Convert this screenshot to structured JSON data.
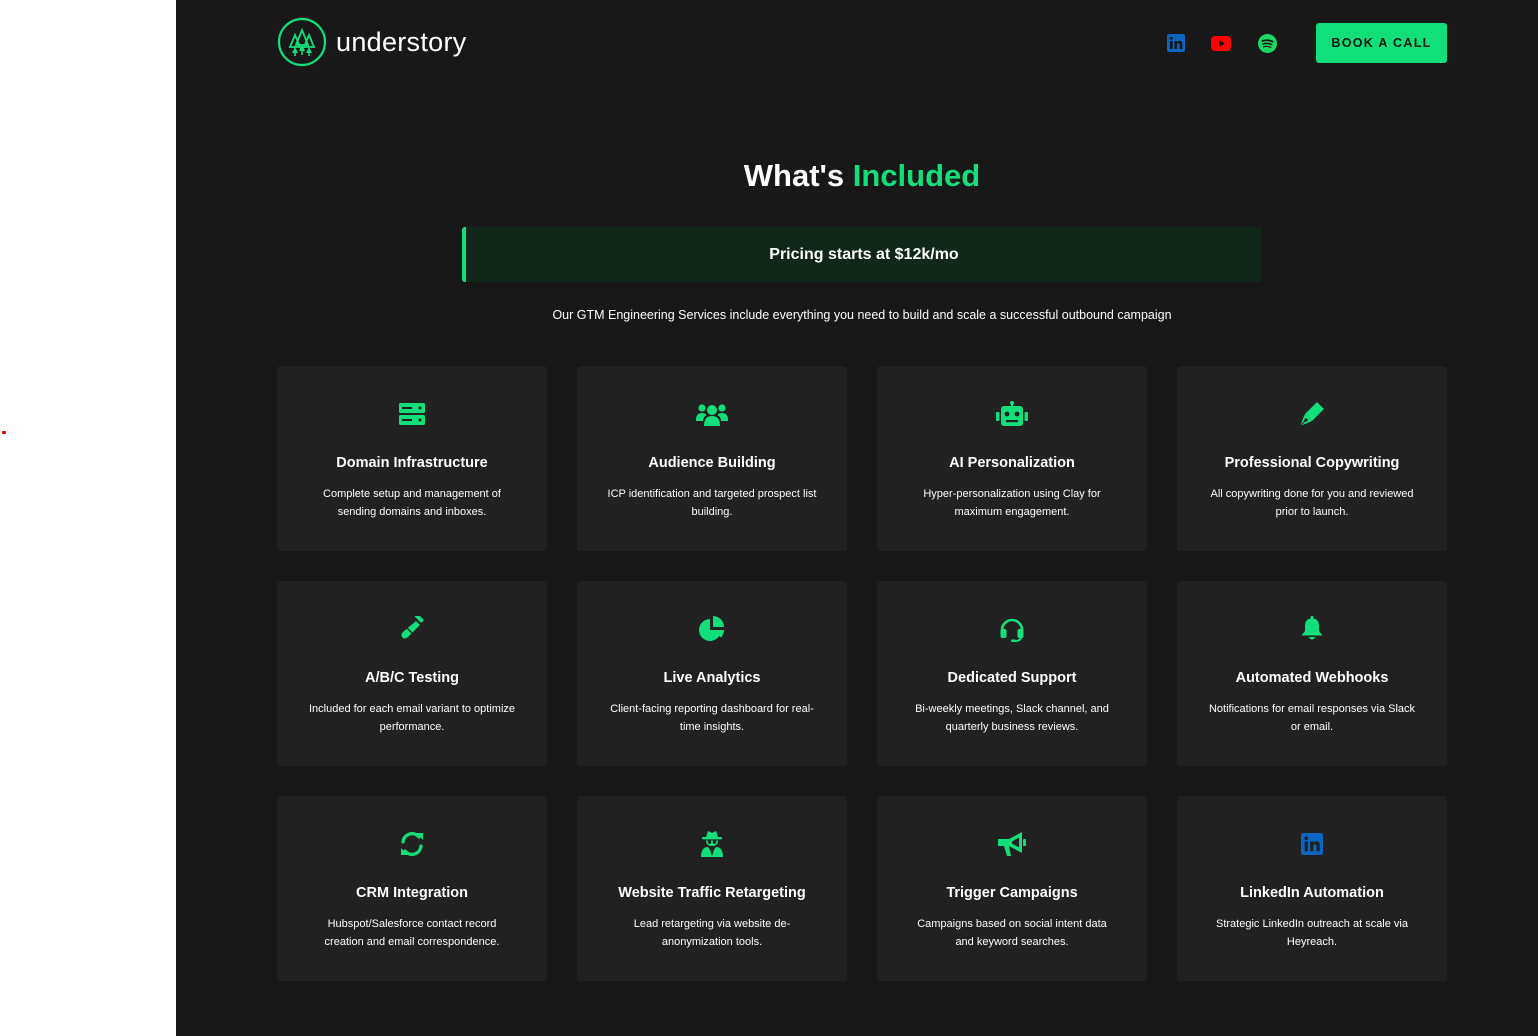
{
  "brand": {
    "name": "understory",
    "accent": "#11e07a"
  },
  "header": {
    "social": [
      {
        "icon": "linkedin-icon",
        "color": "#0a66c2"
      },
      {
        "icon": "youtube-icon",
        "color": "#ff0000"
      },
      {
        "icon": "spotify-icon",
        "color": "#1ed760"
      }
    ],
    "cta_label": "BOOK A CALL"
  },
  "section": {
    "title_main": "What's",
    "title_accent": "Included",
    "pricing": "Pricing starts at $12k/mo",
    "subtitle": "Our GTM Engineering Services include everything you need to build and scale a successful outbound campaign"
  },
  "cards": [
    {
      "icon": "server-icon",
      "title": "Domain Infrastructure",
      "desc": "Complete setup and management of sending domains and inboxes."
    },
    {
      "icon": "users-icon",
      "title": "Audience Building",
      "desc": "ICP identification and targeted prospect list building."
    },
    {
      "icon": "robot-icon",
      "title": "AI Personalization",
      "desc": "Hyper-personalization using Clay for maximum engagement."
    },
    {
      "icon": "pen-icon",
      "title": "Professional Copywriting",
      "desc": "All copywriting done for you and reviewed prior to launch."
    },
    {
      "icon": "vial-icon",
      "title": "A/B/C Testing",
      "desc": "Included for each email variant to optimize performance."
    },
    {
      "icon": "pie-chart-icon",
      "title": "Live Analytics",
      "desc": "Client-facing reporting dashboard for real-time insights."
    },
    {
      "icon": "headset-icon",
      "title": "Dedicated Support",
      "desc": "Bi-weekly meetings, Slack channel, and quarterly business reviews."
    },
    {
      "icon": "bell-icon",
      "title": "Automated Webhooks",
      "desc": "Notifications for email responses via Slack or email."
    },
    {
      "icon": "sync-icon",
      "title": "CRM Integration",
      "desc": "Hubspot/Salesforce contact record creation and email correspondence."
    },
    {
      "icon": "user-secret-icon",
      "title": "Website Traffic Retargeting",
      "desc": "Lead retargeting via website de-anonymization tools."
    },
    {
      "icon": "megaphone-icon",
      "title": "Trigger Campaigns",
      "desc": "Campaigns based on social intent data and keyword searches."
    },
    {
      "icon": "linkedin-icon",
      "title": "LinkedIn Automation",
      "desc": "Strategic LinkedIn outreach at scale via Heyreach."
    }
  ]
}
